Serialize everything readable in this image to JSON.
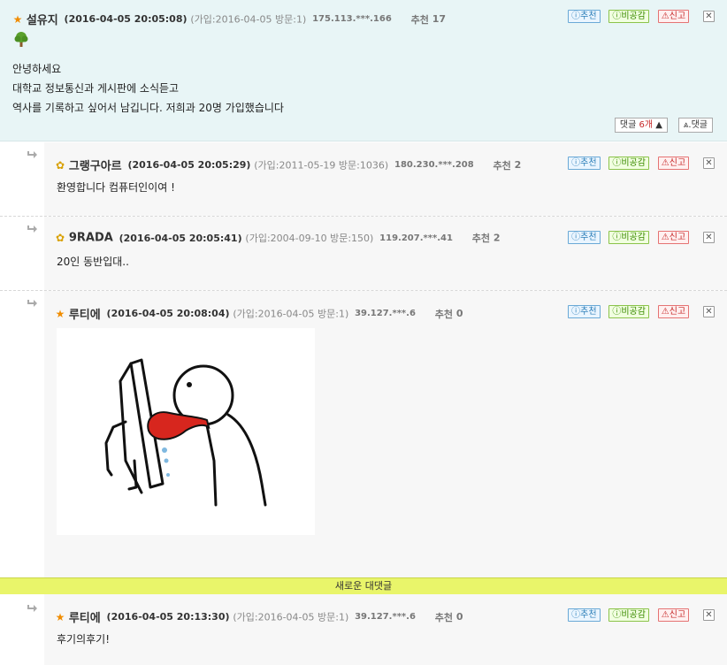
{
  "main_post": {
    "nick": "설유지",
    "date": "(2016-04-05 20:05:08)",
    "join": "(가입:2016-04-05 방문:1)",
    "ip": "175.113.***.166",
    "rec_label": "추천",
    "rec_count": "17",
    "lines": [
      "안녕하세요",
      "대학교 정보통신과 게시판에 소식듣고",
      "역사를 기록하고 싶어서 남깁니다. 저희과 20명 가입했습니다"
    ],
    "comments_label": "댓글",
    "comments_count": "6개",
    "reply_label": "댓글"
  },
  "buttons": {
    "recommend": "추천",
    "blind": "비공감",
    "report": "신고",
    "close": "✕"
  },
  "replies": [
    {
      "nick": "그랭구아르",
      "date": "(2016-04-05 20:05:29)",
      "join": "(가입:2011-05-19 방문:1036)",
      "ip": "180.230.***.208",
      "rec_count": "2",
      "text": "환영합니다 컴퓨터인이여 !"
    },
    {
      "nick": "9RADA",
      "date": "(2016-04-05 20:05:41)",
      "join": "(가입:2004-09-10 방문:150)",
      "ip": "119.207.***.41",
      "rec_count": "2",
      "text": "20인 동반입대.."
    },
    {
      "nick": "루티에",
      "date": "(2016-04-05 20:08:04)",
      "join": "(가입:2016-04-05 방문:1)",
      "ip": "39.127.***.6",
      "rec_count": "0",
      "text": ""
    },
    {
      "nick": "루티에",
      "date": "(2016-04-05 20:13:30)",
      "join": "(가입:2016-04-05 방문:1)",
      "ip": "39.127.***.6",
      "rec_count": "0",
      "text": "후기의후기!"
    }
  ],
  "new_reply_bar": "새로운 대댓글",
  "icons": {
    "star": "star-icon",
    "medal": "medal-icon",
    "tree": "tree-icon",
    "reply_arrow": "reply-arrow-icon"
  }
}
